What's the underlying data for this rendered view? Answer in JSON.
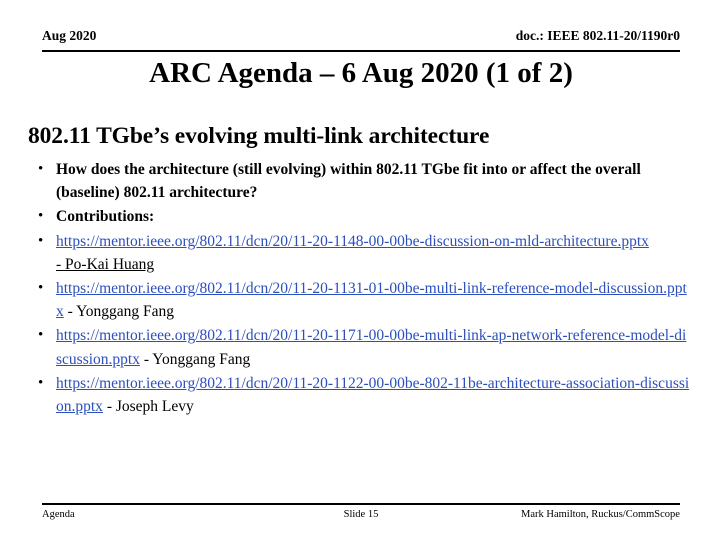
{
  "header": {
    "date": "Aug 2020",
    "doc": "doc.: IEEE 802.11-20/1190r0"
  },
  "title": "ARC Agenda – 6 Aug 2020 (1 of 2)",
  "body": {
    "section_heading": "802.11 TGbe’s evolving multi-link architecture",
    "bullets": [
      {
        "kind": "text",
        "bullet": "•",
        "text": "How does the architecture (still evolving) within 802.11 TGbe fit into or affect the overall (baseline) 802.11 architecture?"
      },
      {
        "kind": "text",
        "bullet": "•",
        "text": "Contributions:"
      },
      {
        "kind": "link",
        "bullet": "•",
        "link": "https://mentor.ieee.org/802.11/dcn/20/11-20-1148-00-00be-discussion-on-mld-architecture.pptx",
        "author": " - Po-Kai Huang",
        "author_underlined": true
      },
      {
        "kind": "link",
        "bullet": "•",
        "link": "https://mentor.ieee.org/802.11/dcn/20/11-20-1131-01-00be-multi-link-reference-model-discussion.pptx",
        "author": " - Yonggang Fang",
        "author_underlined": false
      },
      {
        "kind": "link",
        "bullet": "•",
        "link": "https://mentor.ieee.org/802.11/dcn/20/11-20-1171-00-00be-multi-link-ap-network-reference-model-discussion.pptx",
        "author": " - Yonggang Fang",
        "author_underlined": false
      },
      {
        "kind": "link",
        "bullet": "•",
        "link": "https://mentor.ieee.org/802.11/dcn/20/11-20-1122-00-00be-802-11be-architecture-association-discussion.pptx",
        "author": " - Joseph Levy",
        "author_underlined": false
      }
    ]
  },
  "footer": {
    "left": "Agenda",
    "center": "Slide 15",
    "right": "Mark Hamilton, Ruckus/CommScope"
  },
  "colors": {
    "link": "#2C4FBE",
    "text": "#000000",
    "background": "#FFFFFF"
  }
}
